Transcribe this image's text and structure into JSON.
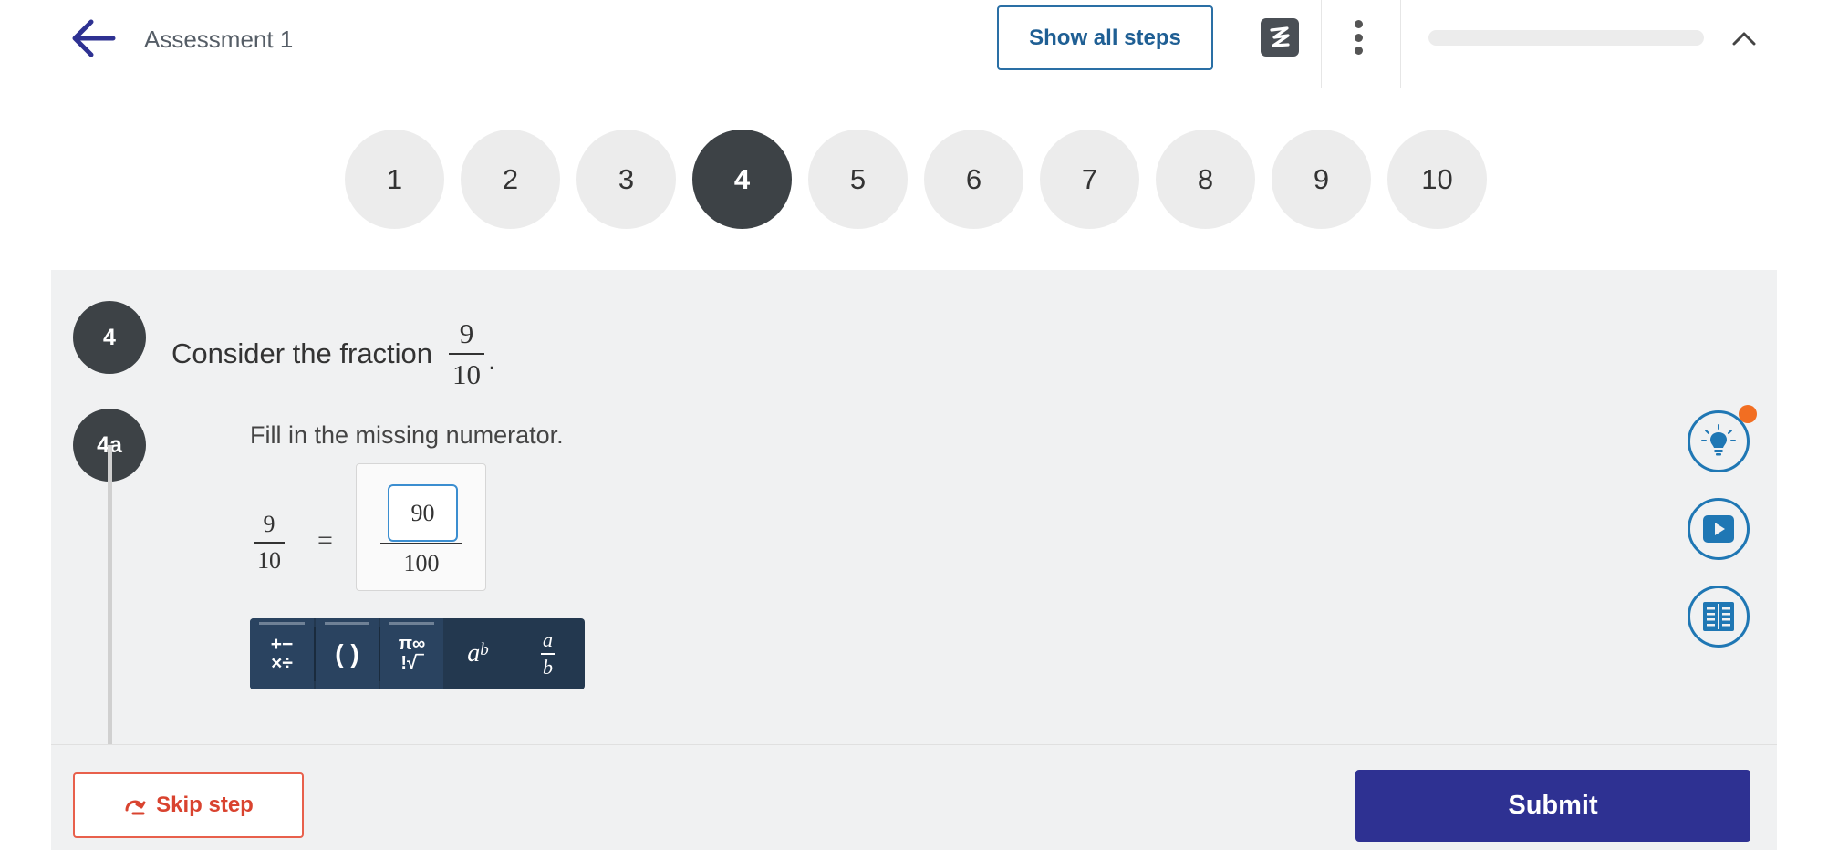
{
  "header": {
    "title": "Assessment 1",
    "show_steps_label": "Show all steps",
    "progress_fraction": 0.0
  },
  "question_nav": [
    "1",
    "2",
    "3",
    "4",
    "5",
    "6",
    "7",
    "8",
    "9",
    "10"
  ],
  "active_question": "4",
  "question": {
    "badge": "4",
    "prompt": "Consider the fraction",
    "fraction": {
      "numerator": "9",
      "denominator": "10"
    },
    "period": "."
  },
  "step": {
    "badge": "4a",
    "instruction": "Fill in the missing numerator.",
    "lhs": {
      "numerator": "9",
      "denominator": "10"
    },
    "equals": "=",
    "answer_value": "90",
    "rhs_denominator": "100"
  },
  "math_toolbar": {
    "ops_top": "+−",
    "ops_bottom": "×÷",
    "parens": "( )",
    "symbols_top": "π∞",
    "symbols_bottom": "!√‾",
    "exponent_base": "a",
    "exponent_power": "b",
    "fraction_num": "a",
    "fraction_den": "b"
  },
  "footer": {
    "skip_label": "Skip step",
    "submit_label": "Submit"
  },
  "colors": {
    "accent_blue": "#1f77b4",
    "submit_navy": "#2e3192",
    "skip_red": "#d9432f",
    "notification": "#f26e22"
  }
}
